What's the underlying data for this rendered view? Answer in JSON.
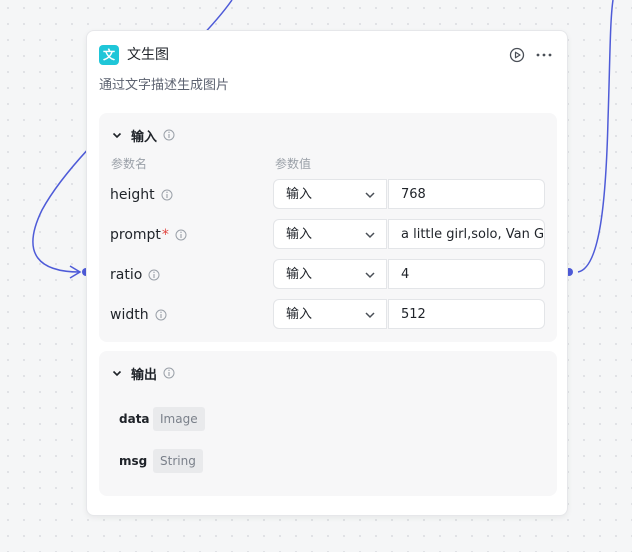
{
  "node": {
    "title": "文生图",
    "icon_glyph": "文",
    "icon_color": "#1fc6d8",
    "description": "通过文字描述生成图片"
  },
  "input": {
    "title": "输入",
    "col_name": "参数名",
    "col_value": "参数值",
    "params": [
      {
        "name": "height",
        "required": false,
        "mode": "输入",
        "value": "768"
      },
      {
        "name": "prompt",
        "required": true,
        "mode": "输入",
        "value": "a little girl,solo, Van Gogh style"
      },
      {
        "name": "ratio",
        "required": false,
        "mode": "输入",
        "value": "4"
      },
      {
        "name": "width",
        "required": false,
        "mode": "输入",
        "value": "512"
      }
    ],
    "required_mark": "*"
  },
  "output": {
    "title": "输出",
    "fields": [
      {
        "name": "data",
        "type": "Image"
      },
      {
        "name": "msg",
        "type": "String"
      }
    ]
  },
  "colors": {
    "edge": "#4e5bd8",
    "required": "#e0443e"
  },
  "icons": [
    "chevron-down-icon",
    "info-icon",
    "play-circle-icon",
    "more-icon"
  ]
}
